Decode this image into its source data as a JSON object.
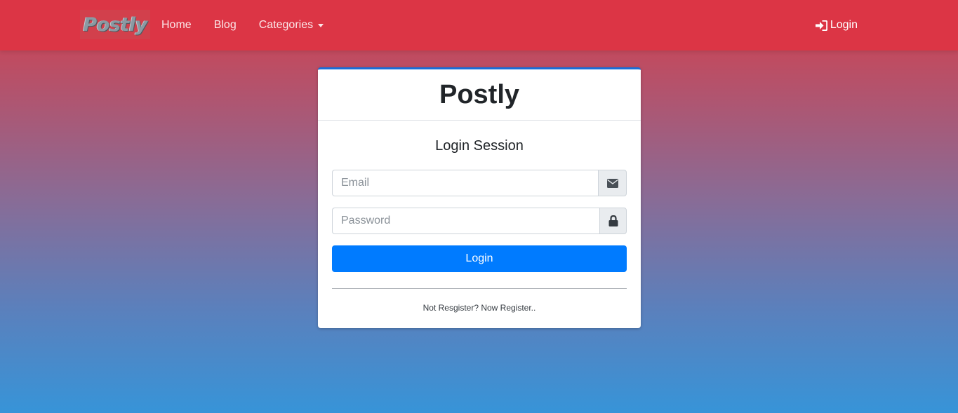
{
  "navbar": {
    "brand": "Postly",
    "links": [
      {
        "label": "Home"
      },
      {
        "label": "Blog"
      },
      {
        "label": "Categories"
      }
    ],
    "login_label": "Login"
  },
  "card": {
    "title": "Postly",
    "subtitle": "Login Session",
    "email": {
      "placeholder": "Email",
      "value": "",
      "icon": "envelope-icon"
    },
    "password": {
      "placeholder": "Password",
      "value": "",
      "icon": "lock-icon"
    },
    "submit_label": "Login",
    "register_text": "Not Resgister? Now Register.."
  },
  "colors": {
    "navbar": "#dc3545",
    "primary": "#007bff",
    "card_top_border": "#1a6ed8",
    "gradient_top": "#c9444f",
    "gradient_bottom": "#3794d8"
  }
}
